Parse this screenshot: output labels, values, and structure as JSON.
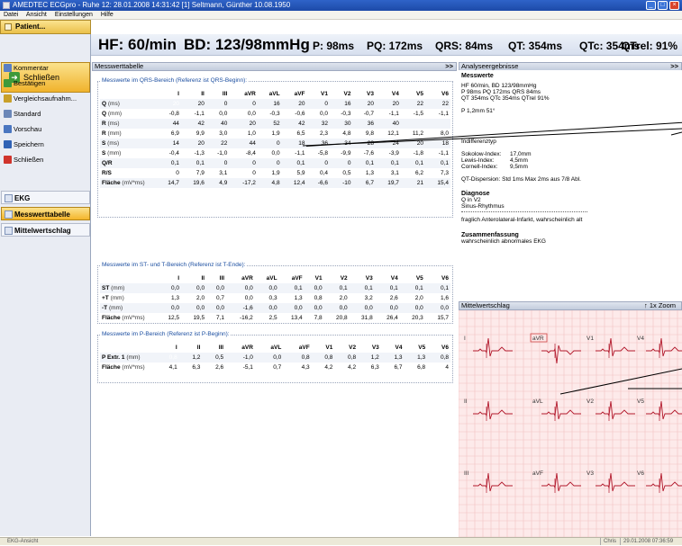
{
  "window": {
    "title": "AMEDTEC ECGpro  -  Ruhe 12: 28.01.2008 14:31:42  [1] Seltmann, Günther 10.08.1950"
  },
  "menu": [
    "Datei",
    "Ansicht",
    "Einstellungen",
    "Hilfe"
  ],
  "sidebar": {
    "patient_label": "Patient...",
    "close_big_label": "Schließen",
    "items": [
      {
        "label": "Kommentar",
        "icon": "comment-icon",
        "color": "#5a7fc4"
      },
      {
        "label": "Bestätigen",
        "icon": "check-icon",
        "color": "#3e9a3a"
      },
      {
        "label": "Vergleichsaufnahm...",
        "icon": "compare-icon",
        "color": "#c9a02a"
      },
      {
        "label": "Standard",
        "icon": "standard-icon",
        "color": "#6b87b8"
      },
      {
        "label": "Vorschau",
        "icon": "preview-icon",
        "color": "#4a76c0"
      },
      {
        "label": "Speichern",
        "icon": "save-icon",
        "color": "#3062b5"
      },
      {
        "label": "Schließen",
        "icon": "close-x-icon",
        "color": "#d0342c"
      }
    ],
    "nav": [
      {
        "label": "EKG",
        "active": false
      },
      {
        "label": "Messwerttabelle",
        "active": true
      },
      {
        "label": "Mittelwertschlag",
        "active": false
      }
    ]
  },
  "vitals": {
    "hf": "HF: 60/min",
    "bd": "BD: 123/98mmHg",
    "p": "P: 98ms",
    "pq": "PQ: 172ms",
    "qrs": "QRS: 84ms",
    "qt": "QT: 354ms",
    "qtc": "QTc: 354ms",
    "qtrel": "QTrel: 91%"
  },
  "table_panel": {
    "header": "Messwerttabelle",
    "collapse": ">>"
  },
  "columns": [
    "I",
    "II",
    "III",
    "aVR",
    "aVL",
    "aVF",
    "V1",
    "V2",
    "V3",
    "V4",
    "V5",
    "V6"
  ],
  "qrs_group": {
    "title": "Messwerte im QRS-Bereich (Referenz ist QRS-Beginn):",
    "rows": [
      {
        "label": "Q",
        "unit": "(ms)",
        "values": [
          "20",
          "20",
          "0",
          "0",
          "16",
          "20",
          "0",
          "16",
          "20",
          "20",
          "22",
          "22"
        ]
      },
      {
        "label": "Q",
        "unit": "(mm)",
        "values": [
          "-0,8",
          "-1,1",
          "0,0",
          "0,0",
          "-0,3",
          "-0,6",
          "0,0",
          "-0,3",
          "-0,7",
          "-1,1",
          "-1,5",
          "-1,1"
        ]
      },
      {
        "label": "R",
        "unit": "(ms)",
        "values": [
          "44",
          "42",
          "40",
          "20",
          "52",
          "42",
          "32",
          "30",
          "36",
          "40",
          "",
          ""
        ]
      },
      {
        "label": "R",
        "unit": "(mm)",
        "values": [
          "6,9",
          "9,9",
          "3,0",
          "1,0",
          "1,9",
          "6,5",
          "2,3",
          "4,8",
          "9,8",
          "12,1",
          "11,2",
          "8,0"
        ]
      },
      {
        "label": "S",
        "unit": "(ms)",
        "values": [
          "14",
          "20",
          "22",
          "44",
          "0",
          "18",
          "36",
          "34",
          "28",
          "24",
          "20",
          "18"
        ]
      },
      {
        "label": "S",
        "unit": "(mm)",
        "values": [
          "-0,4",
          "-1,3",
          "-1,0",
          "-8,4",
          "0,0",
          "-1,1",
          "-5,8",
          "-9,9",
          "-7,6",
          "-3,9",
          "-1,8",
          "-1,1"
        ]
      },
      {
        "label": "Q/R",
        "unit": "",
        "values": [
          "0,1",
          "0,1",
          "0",
          "0",
          "0",
          "0,1",
          "0",
          "0",
          "0,1",
          "0,1",
          "0,1",
          "0,1"
        ]
      },
      {
        "label": "R/S",
        "unit": "",
        "values": [
          "0",
          "7,9",
          "3,1",
          "0",
          "1,9",
          "5,9",
          "0,4",
          "0,5",
          "1,3",
          "3,1",
          "6,2",
          "7,3"
        ]
      },
      {
        "label": "Fläche",
        "unit": "(mV*ms)",
        "values": [
          "14,7",
          "19,6",
          "4,9",
          "-17,2",
          "4,8",
          "12,4",
          "-6,6",
          "-10",
          "6,7",
          "19,7",
          "21",
          "15,4"
        ]
      }
    ]
  },
  "st_group": {
    "title": "Messwerte im ST- und T-Bereich (Referenz ist T-Ende):",
    "rows": [
      {
        "label": "ST",
        "unit": "(mm)",
        "values": [
          "0,0",
          "0,0",
          "0,0",
          "0,0",
          "0,0",
          "0,1",
          "0,0",
          "0,1",
          "0,1",
          "0,1",
          "0,1",
          "0,1"
        ]
      },
      {
        "label": "+T",
        "unit": "(mm)",
        "values": [
          "1,3",
          "2,0",
          "0,7",
          "0,0",
          "0,3",
          "1,3",
          "0,8",
          "2,0",
          "3,2",
          "2,6",
          "2,0",
          "1,6"
        ]
      },
      {
        "label": "-T",
        "unit": "(mm)",
        "values": [
          "0,0",
          "0,0",
          "0,0",
          "-1,6",
          "0,0",
          "0,0",
          "0,0",
          "0,0",
          "0,0",
          "0,0",
          "0,0",
          "0,0"
        ]
      },
      {
        "label": "Fläche",
        "unit": "(mV*ms)",
        "values": [
          "12,5",
          "19,5",
          "7,1",
          "-16,2",
          "2,5",
          "13,4",
          "7,8",
          "20,8",
          "31,8",
          "26,4",
          "20,3",
          "15,7"
        ]
      }
    ]
  },
  "p_group": {
    "title": "Messwerte im P-Bereich (Referenz ist P-Beginn):",
    "rows": [
      {
        "label": "P Extr. 1",
        "unit": "(mm)",
        "values": [
          "0,8",
          "1,2",
          "0,5",
          "-1,0",
          "0,0",
          "0,8",
          "0,8",
          "0,8",
          "1,2",
          "1,3",
          "1,3",
          "0,8"
        ]
      },
      {
        "label": "Fläche",
        "unit": "(mV*ms)",
        "values": [
          "4,1",
          "6,3",
          "2,6",
          "-5,1",
          "0,7",
          "4,3",
          "4,2",
          "4,2",
          "6,3",
          "6,7",
          "6,8",
          "4"
        ]
      }
    ]
  },
  "analysis": {
    "header": "Analyseergebnisse",
    "collapse": ">>",
    "messwerte_title": "Messwerte",
    "lines": [
      "HF 60/min, BD 123/98mmHg",
      "P     98ms      PQ    172ms     QRS  84ms",
      "QT   354ms     QTc  354ms     QTrel 91%",
      "P          1,2mm     51°"
    ],
    "indifferenz": "Indifferenztyp",
    "sokolow_label": "Sokolow-Index:",
    "sokolow_value": "17,0mm",
    "lewis_label": "Lewis-Index:",
    "lewis_value": "4,5mm",
    "cornell_label": "Cornell-Index:",
    "cornell_value": "9,5mm",
    "qt_dispersion": "QT-Dispersion: Std 1ms  Max 2ms aus 7/8 Abl.",
    "diagnose_title": "Diagnose",
    "diagnose_lines": [
      "Q in           V2",
      "Sinus-Rhythmus"
    ],
    "finding": "fraglich Anterolateral-Infarkt, wahrscheinlich alt",
    "summary_title": "Zusammenfassung",
    "summary": "wahrscheinlich abnormales EKG"
  },
  "ecg_panel": {
    "header": "Mittelwertschlag",
    "zoom_label": "1x Zoom",
    "leads": [
      "I",
      "aVR",
      "V1",
      "V4",
      "II",
      "aVL",
      "V2",
      "V5",
      "III",
      "aVF",
      "V3",
      "V6"
    ]
  },
  "statusbar": {
    "left": "EKG-Ansicht",
    "user": "Chris",
    "datetime": "29.01.2008 07:36:59"
  }
}
